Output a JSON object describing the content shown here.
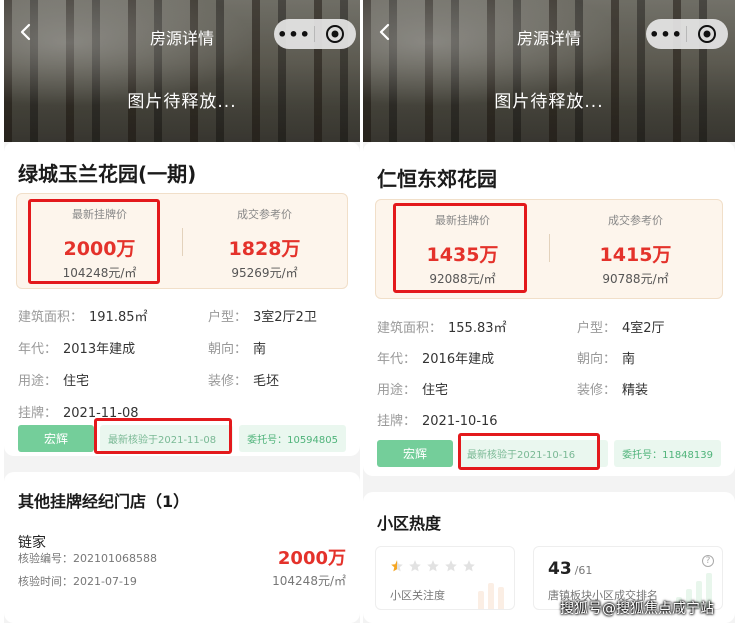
{
  "panels": [
    {
      "header_title": "房源详情",
      "image_placeholder": "图片待释放...",
      "listing_title": "绿城玉兰花园(一期)",
      "price": {
        "listing_label": "最新挂牌价",
        "listing_value": "2000万",
        "listing_unit": "104248元/㎡",
        "deal_label": "成交参考价",
        "deal_value": "1828万",
        "deal_unit": "95269元/㎡"
      },
      "attrs": [
        {
          "k": "建筑面积：",
          "v": "191.85㎡"
        },
        {
          "k": "户型：",
          "v": "3室2厅2卫"
        },
        {
          "k": "年代：",
          "v": "2013年建成"
        },
        {
          "k": "朝向：",
          "v": "南"
        },
        {
          "k": "用途：",
          "v": "住宅"
        },
        {
          "k": "装修：",
          "v": "毛坯"
        },
        {
          "k": "挂牌：",
          "v": "2021-11-08"
        }
      ],
      "tags": {
        "agent": "宏辉",
        "verify": "最新核验于2021-11-08",
        "entrust": "委托号：10594805"
      },
      "section_title": "其他挂牌经纪门店（1）",
      "agency": {
        "name": "链家",
        "code": "核验编号：202101068588",
        "time": "核验时间：2021-07-19",
        "price": "2000万",
        "unit": "104248元/㎡"
      }
    },
    {
      "header_title": "房源详情",
      "image_placeholder": "图片待释放...",
      "listing_title": "仁恒东郊花园",
      "price": {
        "listing_label": "最新挂牌价",
        "listing_value": "1435万",
        "listing_unit": "92088元/㎡",
        "deal_label": "成交参考价",
        "deal_value": "1415万",
        "deal_unit": "90788元/㎡"
      },
      "attrs": [
        {
          "k": "建筑面积：",
          "v": "155.83㎡"
        },
        {
          "k": "户型：",
          "v": "4室2厅"
        },
        {
          "k": "年代：",
          "v": "2016年建成"
        },
        {
          "k": "朝向：",
          "v": "南"
        },
        {
          "k": "用途：",
          "v": "住宅"
        },
        {
          "k": "装修：",
          "v": "精装"
        },
        {
          "k": "挂牌：",
          "v": "2021-10-16"
        }
      ],
      "tags": {
        "agent": "宏辉",
        "verify": "最新核验于2021-10-16",
        "entrust": "委托号：11848139"
      },
      "section_title": "小区热度",
      "heat": {
        "attention_label": "小区关注度",
        "attention_stars": 0.5,
        "rank_value": "43",
        "rank_total": "/61",
        "rank_label": "唐镇板块小区成交排名"
      }
    }
  ],
  "watermark": "搜狐号@搜狐焦点咸宁站",
  "colors": {
    "price_red": "#e4322b",
    "highlight_red": "#e3191c",
    "agent_green": "#74ce9a"
  }
}
